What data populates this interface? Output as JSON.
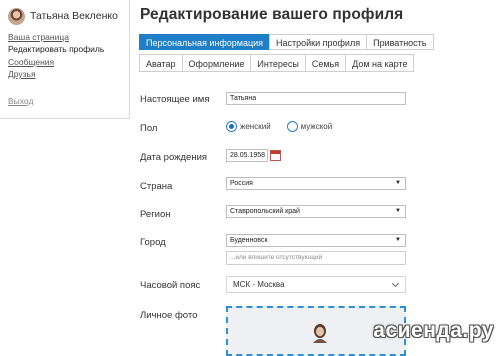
{
  "sidebar": {
    "user_name": "Татьяна Векленко",
    "links": [
      {
        "label": "Ваша страница"
      },
      {
        "label": "Редактировать профиль"
      },
      {
        "label": "Сообщения"
      },
      {
        "label": "Друзья"
      }
    ],
    "logout_label": "Выход"
  },
  "page_title": "Редактирование вашего профиля",
  "tabs_primary": [
    {
      "label": "Персональная информация",
      "active": true
    },
    {
      "label": "Настройки профиля"
    },
    {
      "label": "Приватность"
    }
  ],
  "tabs_secondary": [
    {
      "label": "Аватар"
    },
    {
      "label": "Оформление"
    },
    {
      "label": "Интересы"
    },
    {
      "label": "Семья"
    },
    {
      "label": "Дом на карте"
    }
  ],
  "form": {
    "real_name": {
      "label": "Настоящее имя",
      "value": "Татьяна"
    },
    "gender": {
      "label": "Пол",
      "options": [
        "женский",
        "мужской"
      ],
      "selected": "женский"
    },
    "birth_date": {
      "label": "Дата рождения",
      "value": "28.05.1958"
    },
    "country": {
      "label": "Страна",
      "value": "Россия"
    },
    "region": {
      "label": "Регион",
      "value": "Ставропольский край"
    },
    "city": {
      "label": "Город",
      "value": "Буденновск",
      "alt_placeholder": "...или впишите отсутствующий"
    },
    "timezone": {
      "label": "Часовой пояс",
      "value": "МСК - Москва"
    },
    "photo": {
      "label": "Личное фото"
    }
  },
  "watermark": "асиенда.ру",
  "colors": {
    "accent": "#1f7fc6",
    "photo_border": "#2d8fd6"
  }
}
